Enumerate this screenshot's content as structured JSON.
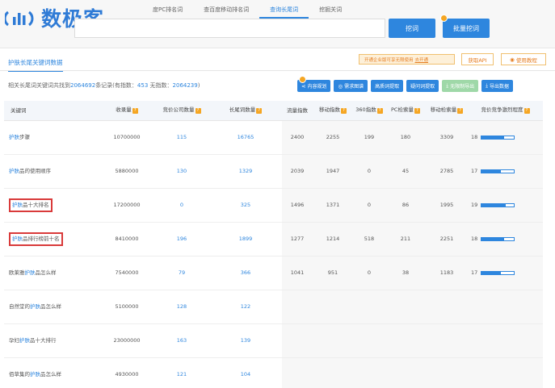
{
  "logo": {
    "text": "数极客"
  },
  "tabs": [
    {
      "label": "度PC排名词",
      "active": false
    },
    {
      "label": "查百度移动排名词",
      "active": false
    },
    {
      "label": "查询长尾词",
      "active": true
    },
    {
      "label": "挖掘关词",
      "active": false
    }
  ],
  "search": {
    "value": "",
    "dig_label": "挖词",
    "batch_label": "批量挖词"
  },
  "section": {
    "title": "护肤长尾关键词数据"
  },
  "promo": {
    "text": "开通企业版可享无限使用",
    "link": "去开通",
    "api_label": "获取API",
    "guide_label": "使用教程"
  },
  "summary": {
    "prefix": "相关长尾词关键词共找到",
    "count": "2064692",
    "middle": "条记录(有指数：",
    "indexed": "453",
    "sep": "  无指数：",
    "unindexed": "2064239",
    "suffix": ")"
  },
  "actions": [
    {
      "label": "内容规划",
      "icon": "share-icon",
      "disabled": false
    },
    {
      "label": "需求图谱",
      "icon": "eye-icon",
      "disabled": false
    },
    {
      "label": "高质词提取",
      "icon": "",
      "disabled": false
    },
    {
      "label": "疑问词提取",
      "icon": "",
      "disabled": false
    },
    {
      "label": "无限制导出",
      "icon": "download-icon",
      "disabled": true
    },
    {
      "label": "导出数据",
      "icon": "download-icon",
      "disabled": false
    }
  ],
  "table": {
    "headers": {
      "keyword": "关键词",
      "volume": "收录量",
      "bidders": "竞价公司数量",
      "longtail": "长尾词数量",
      "flow": "流量指数",
      "mobile": "移动指数",
      "s360": "360指数",
      "pc_bid": "PC检索量",
      "mobile_bid": "移动检索量",
      "competition": "竞价竞争激烈程度"
    },
    "rows": [
      {
        "pre": "",
        "hl": "护肤",
        "post": "步骤",
        "volume": "10700000",
        "bidders": "115",
        "longtail": "16765",
        "flow": "2400",
        "mobile": "2255",
        "s360": "199",
        "pc": "180",
        "mobile_bid": "3309",
        "comp": "18",
        "comp_fill": 0.7,
        "boxed": false
      },
      {
        "pre": "",
        "hl": "护肤",
        "post": "品的使用顺序",
        "volume": "5880000",
        "bidders": "130",
        "longtail": "1329",
        "flow": "2039",
        "mobile": "1947",
        "s360": "0",
        "pc": "45",
        "mobile_bid": "2785",
        "comp": "17",
        "comp_fill": 0.6,
        "boxed": false
      },
      {
        "pre": "",
        "hl": "护肤",
        "post": "品十大排名",
        "volume": "17200000",
        "bidders": "0",
        "longtail": "325",
        "flow": "1496",
        "mobile": "1371",
        "s360": "0",
        "pc": "86",
        "mobile_bid": "1995",
        "comp": "19",
        "comp_fill": 0.75,
        "boxed": true
      },
      {
        "pre": "",
        "hl": "护肤",
        "post": "品排行榜前十名",
        "volume": "8410000",
        "bidders": "196",
        "longtail": "1899",
        "flow": "1277",
        "mobile": "1214",
        "s360": "518",
        "pc": "211",
        "mobile_bid": "2251",
        "comp": "18",
        "comp_fill": 0.7,
        "boxed": true
      },
      {
        "pre": "欧莱雅",
        "hl": "护肤",
        "post": "品怎么样",
        "volume": "7540000",
        "bidders": "79",
        "longtail": "366",
        "flow": "1041",
        "mobile": "951",
        "s360": "0",
        "pc": "38",
        "mobile_bid": "1183",
        "comp": "17",
        "comp_fill": 0.6,
        "boxed": false
      },
      {
        "pre": "自然堂的",
        "hl": "护肤",
        "post": "品怎么样",
        "volume": "5100000",
        "bidders": "128",
        "longtail": "122",
        "flow": "",
        "mobile": "",
        "s360": "",
        "pc": "",
        "mobile_bid": "",
        "comp": "",
        "comp_fill": 0,
        "boxed": false
      },
      {
        "pre": "孕妇",
        "hl": "护肤",
        "post": "品十大排行",
        "volume": "23000000",
        "bidders": "163",
        "longtail": "139",
        "flow": "",
        "mobile": "",
        "s360": "",
        "pc": "",
        "mobile_bid": "",
        "comp": "",
        "comp_fill": 0,
        "boxed": false
      },
      {
        "pre": "佰草集的",
        "hl": "护肤",
        "post": "品怎么样",
        "volume": "4930000",
        "bidders": "121",
        "longtail": "104",
        "flow": "",
        "mobile": "",
        "s360": "",
        "pc": "",
        "mobile_bid": "",
        "comp": "",
        "comp_fill": 0,
        "boxed": false
      }
    ]
  },
  "colors": {
    "accent": "#2e86de",
    "warning": "#f5a623",
    "highlight_box": "#d93a3a"
  }
}
